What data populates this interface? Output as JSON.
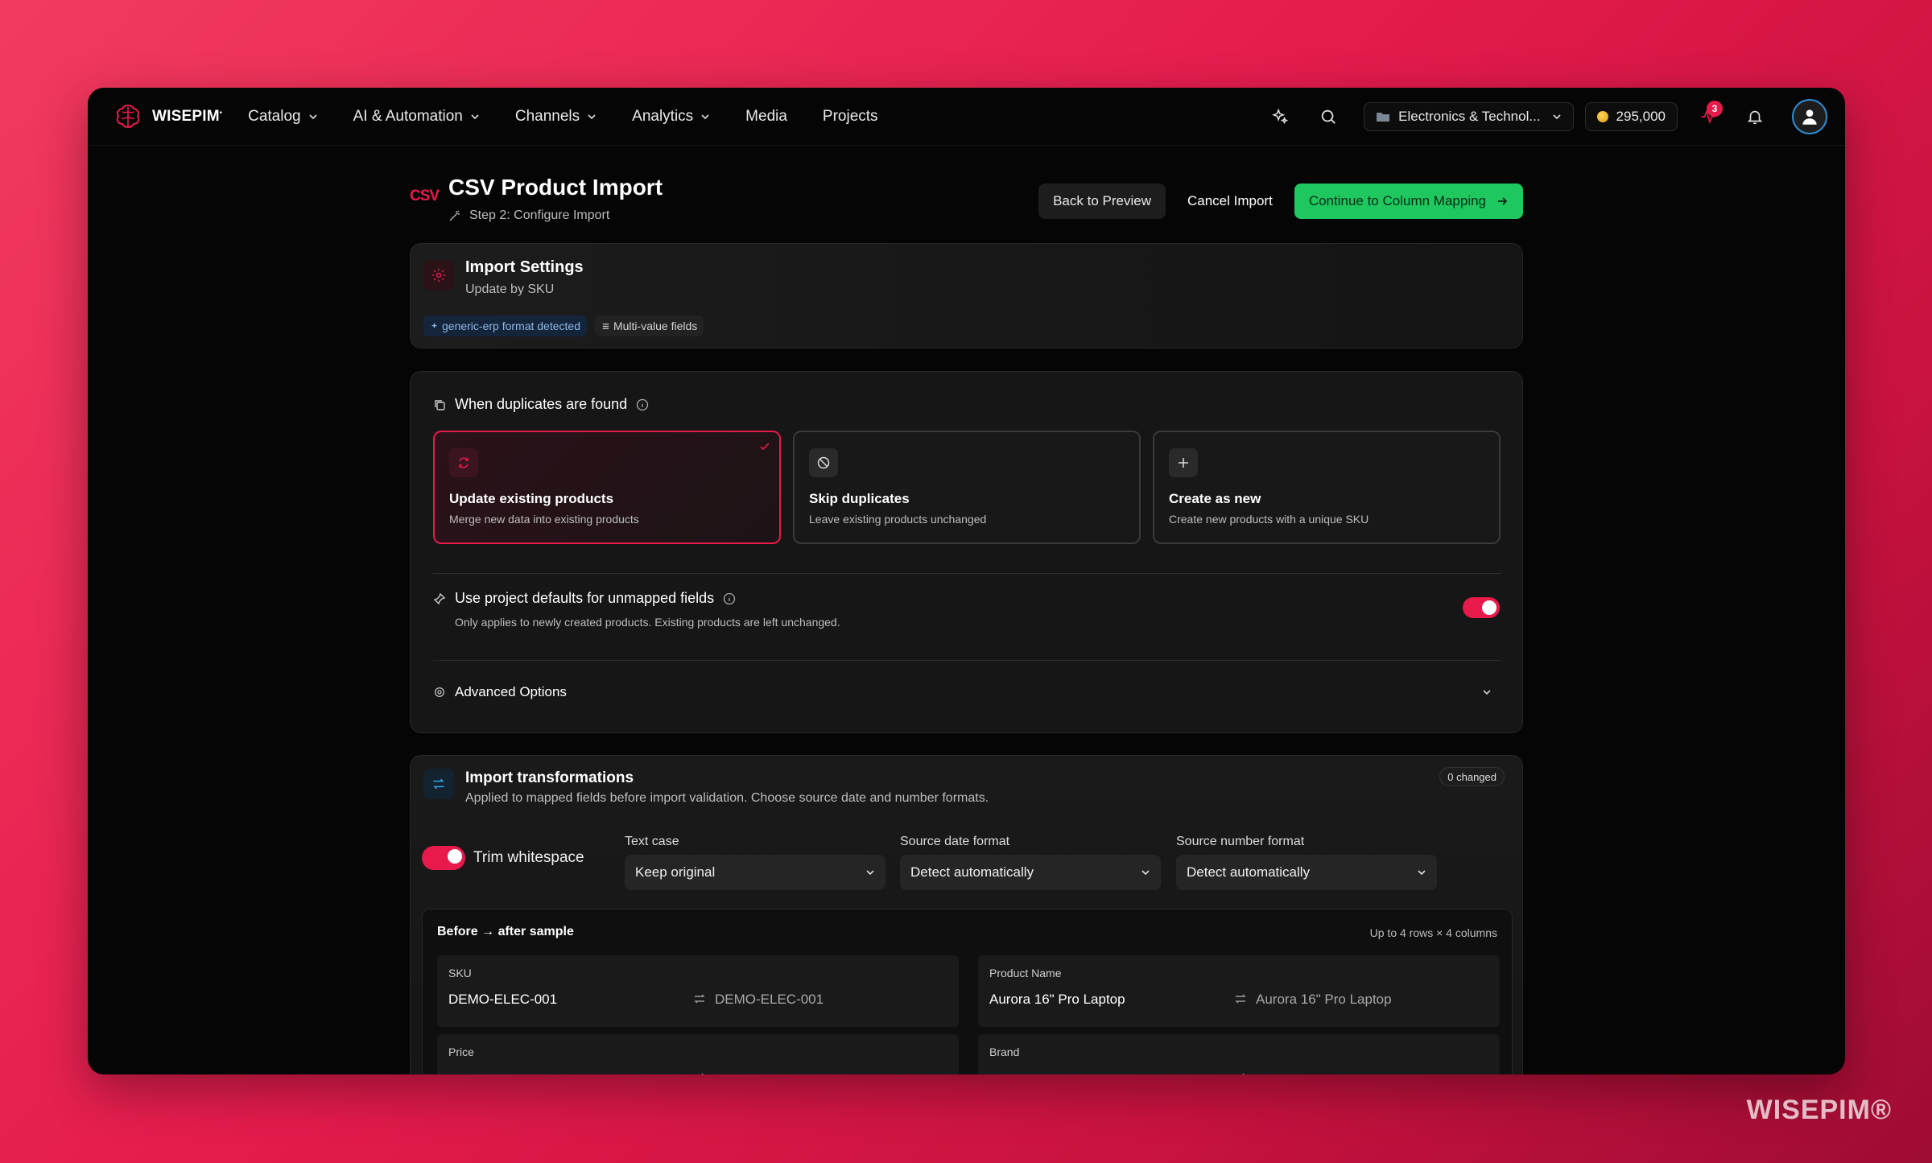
{
  "brand": {
    "name": "WISEPIM",
    "mark": "•",
    "watermark": "WISEPIM®"
  },
  "nav": {
    "items": [
      {
        "label": "Catalog",
        "dropdown": true
      },
      {
        "label": "AI & Automation",
        "dropdown": true
      },
      {
        "label": "Channels",
        "dropdown": true
      },
      {
        "label": "Analytics",
        "dropdown": true
      },
      {
        "label": "Media",
        "dropdown": false
      },
      {
        "label": "Projects",
        "dropdown": false
      }
    ],
    "org": "Electronics & Technol...",
    "credits": "295,000",
    "notifications": "3"
  },
  "page": {
    "csv_label": "CSV",
    "title": "CSV Product Import",
    "step": "Step 2: Configure Import",
    "back": "Back to Preview",
    "cancel": "Cancel Import",
    "continue": "Continue to Column Mapping"
  },
  "settings": {
    "title": "Import Settings",
    "subtitle": "Update by SKU",
    "chip_format": "generic-erp format detected",
    "chip_multi": "Multi-value fields"
  },
  "duplicates": {
    "heading": "When duplicates are found",
    "options": [
      {
        "title": "Update existing products",
        "desc": "Merge new data into existing products",
        "selected": true
      },
      {
        "title": "Skip duplicates",
        "desc": "Leave existing products unchanged",
        "selected": false
      },
      {
        "title": "Create as new",
        "desc": "Create new products with a unique SKU",
        "selected": false
      }
    ],
    "defaults_title": "Use project defaults for unmapped fields",
    "defaults_desc": "Only applies to newly created products. Existing products are left unchanged.",
    "defaults_on": true,
    "advanced": "Advanced Options"
  },
  "transform": {
    "title": "Import transformations",
    "desc": "Applied to mapped fields before import validation. Choose source date and number formats.",
    "changed": "0 changed",
    "trim_label": "Trim whitespace",
    "trim_on": true,
    "text_case_label": "Text case",
    "text_case_value": "Keep original",
    "date_label": "Source date format",
    "date_value": "Detect automatically",
    "number_label": "Source number format",
    "number_value": "Detect automatically",
    "sample_title": "Before → after sample",
    "sample_limit": "Up to 4 rows × 4 columns",
    "sample_cells": [
      {
        "label": "SKU",
        "before": "DEMO-ELEC-001",
        "after": "DEMO-ELEC-001"
      },
      {
        "label": "Product Name",
        "before": "Aurora 16\" Pro Laptop",
        "after": "Aurora 16\" Pro Laptop"
      },
      {
        "label": "Price",
        "before": "",
        "after": ""
      },
      {
        "label": "Brand",
        "before": "",
        "after": ""
      }
    ]
  },
  "colors": {
    "accent": "#e8194b",
    "primary": "#1fc85f",
    "background": "#050505"
  }
}
